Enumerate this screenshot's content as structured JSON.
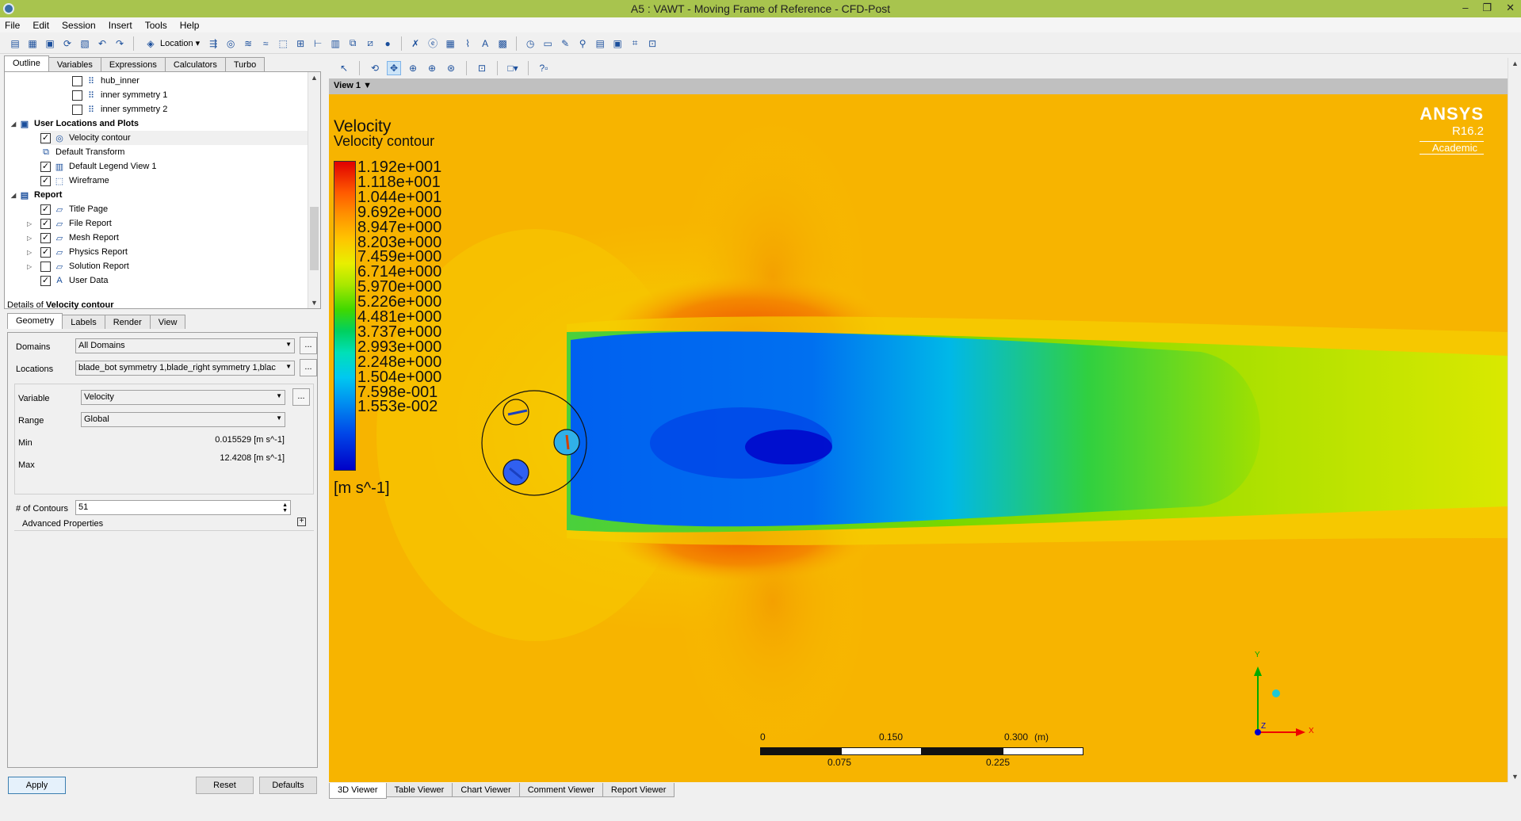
{
  "window": {
    "title": "A5 : VAWT - Moving Frame of Reference - CFD-Post",
    "min": "–",
    "max": "❐",
    "close": "✕"
  },
  "menu": [
    "File",
    "Edit",
    "Session",
    "Insert",
    "Tools",
    "Help"
  ],
  "toolbar": {
    "location_label": "Location"
  },
  "left_tabs": [
    "Outline",
    "Variables",
    "Expressions",
    "Calculators",
    "Turbo"
  ],
  "tree": [
    {
      "label": "hub_inner",
      "checked": false
    },
    {
      "label": "inner symmetry 1",
      "checked": false
    },
    {
      "label": "inner symmetry 2",
      "checked": false
    },
    {
      "label": "User Locations and Plots"
    },
    {
      "label": "Velocity contour",
      "checked": true
    },
    {
      "label": "Default Transform"
    },
    {
      "label": "Default Legend View 1",
      "checked": true
    },
    {
      "label": "Wireframe",
      "checked": true
    },
    {
      "label": "Report"
    },
    {
      "label": "Title Page",
      "checked": true
    },
    {
      "label": "File Report",
      "checked": true
    },
    {
      "label": "Mesh Report",
      "checked": true
    },
    {
      "label": "Physics Report",
      "checked": true
    },
    {
      "label": "Solution Report",
      "checked": false
    },
    {
      "label": "User Data",
      "checked": true
    }
  ],
  "details": {
    "prefix": "Details of ",
    "object": "Velocity contour",
    "tabs": [
      "Geometry",
      "Labels",
      "Render",
      "View"
    ],
    "domains_label": "Domains",
    "domains_value": "All Domains",
    "locations_label": "Locations",
    "locations_value": "blade_bot symmetry 1,blade_right symmetry 1,blac",
    "variable_label": "Variable",
    "variable_value": "Velocity",
    "range_label": "Range",
    "range_value": "Global",
    "min_label": "Min",
    "min_value": "0.015529 [m s^-1]",
    "max_label": "Max",
    "max_value": "12.4208 [m s^-1]",
    "contours_label": "# of Contours",
    "contours_value": "51",
    "advanced": "Advanced Properties",
    "dots": "...",
    "apply": "Apply",
    "reset": "Reset",
    "defaults": "Defaults"
  },
  "viewer": {
    "view_title": "View 1",
    "bottom_tabs": [
      "3D Viewer",
      "Table Viewer",
      "Chart Viewer",
      "Comment Viewer",
      "Report Viewer"
    ]
  },
  "legend": {
    "title": "Velocity",
    "subtitle": "Velocity contour",
    "ticks": [
      "1.192e+001",
      "1.118e+001",
      "1.044e+001",
      "9.692e+000",
      "8.947e+000",
      "8.203e+000",
      "7.459e+000",
      "6.714e+000",
      "5.970e+000",
      "5.226e+000",
      "4.481e+000",
      "3.737e+000",
      "2.993e+000",
      "2.248e+000",
      "1.504e+000",
      "7.598e-001",
      "1.553e-002"
    ],
    "unit": "[m s^-1]"
  },
  "logo": {
    "line1": "ANSYS",
    "line2": "R16.2",
    "line3": "Academic"
  },
  "scale": {
    "l0": "0",
    "l1": "0.150",
    "l2": "0.300",
    "unit": "(m)",
    "l3": "0.075",
    "l4": "0.225"
  },
  "axes": {
    "y": "Y",
    "x": "X",
    "z": "Z"
  },
  "colors": {
    "titlebar": "#a8c44e",
    "contour_background": "#f7c200"
  }
}
